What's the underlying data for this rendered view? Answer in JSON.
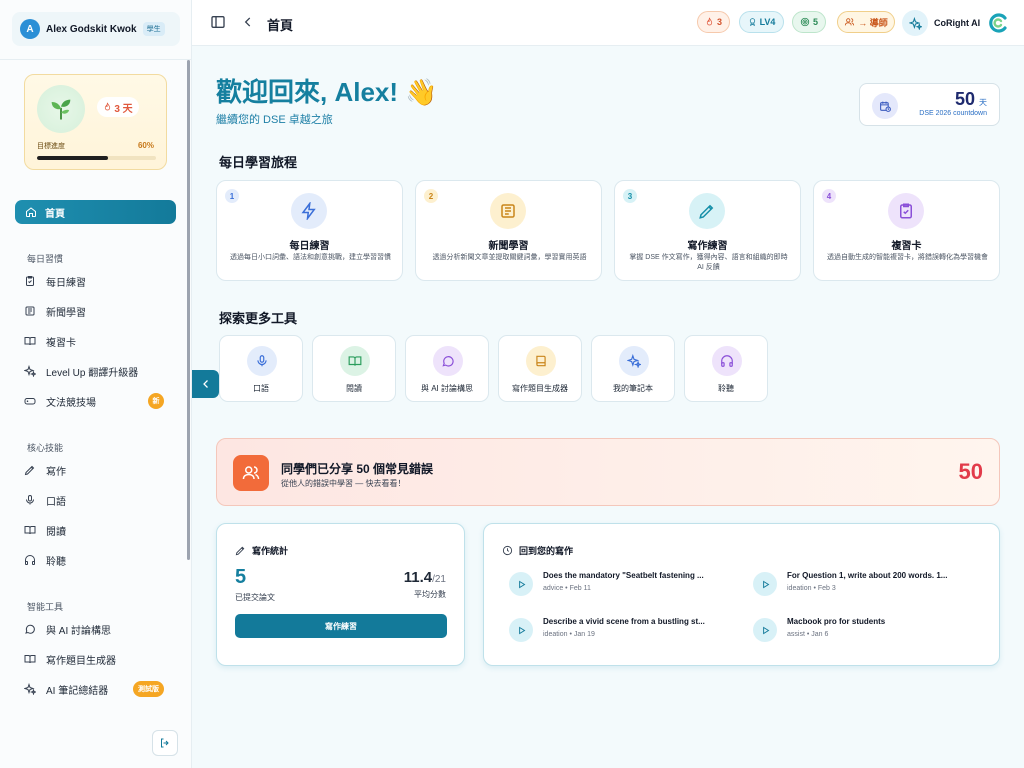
{
  "user": {
    "initial": "A",
    "name": "Alex Godskit Kwok",
    "role": "學生"
  },
  "streak": {
    "days": "3 天",
    "goal_label": "目標進度",
    "goal_pct_text": "60%",
    "goal_fraction": 0.6
  },
  "sidebar": {
    "home": "首頁",
    "sections": [
      {
        "label": "每日習慣",
        "items": [
          {
            "label": "每日練習",
            "icon": "clipboard-check-icon"
          },
          {
            "label": "新聞學習",
            "icon": "newspaper-icon"
          },
          {
            "label": "複習卡",
            "icon": "book-open-icon"
          },
          {
            "label": "Level Up 翻譯升級器",
            "icon": "sparkles-icon"
          },
          {
            "label": "文法競技場",
            "icon": "gamepad-icon",
            "badge": "新"
          }
        ]
      },
      {
        "label": "核心技能",
        "items": [
          {
            "label": "寫作",
            "icon": "pen-icon"
          },
          {
            "label": "口語",
            "icon": "mic-icon"
          },
          {
            "label": "閱讀",
            "icon": "book-open-icon"
          },
          {
            "label": "聆聽",
            "icon": "headphones-icon"
          }
        ]
      },
      {
        "label": "智能工具",
        "items": [
          {
            "label": "與 AI 討論構思",
            "icon": "chat-icon"
          },
          {
            "label": "寫作題目生成器",
            "icon": "book-open-icon"
          },
          {
            "label": "AI 筆記總結器",
            "icon": "sparkles-icon",
            "badge": "測試版"
          }
        ]
      }
    ]
  },
  "topbar": {
    "title": "首頁",
    "streak_count": "3",
    "level": "LV4",
    "coins": "5",
    "tutor_label": "→ 導師",
    "brand": "CoRight AI"
  },
  "hero": {
    "title": "歡迎回來, Alex! 👋",
    "subtitle": "繼續您的 DSE 卓越之旅"
  },
  "countdown": {
    "number": "50",
    "unit": "天",
    "label": "DSE 2026 countdown"
  },
  "journey": {
    "heading": "每日學習旅程",
    "cards": [
      {
        "num": "1",
        "title": "每日練習",
        "desc": "透過每日小口詞彙、語法和創意挑戰，建立學習習慣",
        "icon": "lightning-icon",
        "color": "#3b6fd8",
        "bg": "#e3ecfb",
        "numbg": "#e3ecfb"
      },
      {
        "num": "2",
        "title": "新聞學習",
        "desc": "透過分析新聞文章並提取關鍵詞彙，學習實用英語",
        "icon": "newspaper-icon",
        "color": "#c9851a",
        "bg": "#fdf0cf",
        "numbg": "#fdf0cf"
      },
      {
        "num": "3",
        "title": "寫作練習",
        "desc": "掌握 DSE 作文寫作，獲得內容、語言和組織的即時 AI 反饋",
        "icon": "pen-icon",
        "color": "#158fa8",
        "bg": "#d7f2f6",
        "numbg": "#d7f2f6"
      },
      {
        "num": "4",
        "title": "複習卡",
        "desc": "透過自動生成的智能複習卡，將錯誤轉化為學習機會",
        "icon": "clipboard-check-icon",
        "color": "#8a4fd8",
        "bg": "#eee3fb",
        "numbg": "#eee3fb"
      }
    ]
  },
  "tools": {
    "heading": "探索更多工具",
    "items": [
      {
        "label": "口語",
        "icon": "mic-icon",
        "color": "#3b6fd8",
        "bg": "#e3ecfb"
      },
      {
        "label": "閱讀",
        "icon": "book-open-icon",
        "color": "#2a9d5c",
        "bg": "#dcf3e5"
      },
      {
        "label": "與 AI 討論構思",
        "icon": "chat-icon",
        "color": "#8a4fd8",
        "bg": "#eee3fb"
      },
      {
        "label": "寫作題目生成器",
        "icon": "book-icon",
        "color": "#c9851a",
        "bg": "#fdf0cf"
      },
      {
        "label": "我的筆記本",
        "icon": "sparkles-icon",
        "color": "#3b6fd8",
        "bg": "#e3ecfb"
      },
      {
        "label": "聆聽",
        "icon": "headphones-icon",
        "color": "#8a4fd8",
        "bg": "#eee3fb"
      }
    ]
  },
  "banner": {
    "title": "同學們已分享 50 個常見錯誤",
    "subtitle": "從他人的錯誤中學習 — 快去看看！",
    "count": "50"
  },
  "stats": {
    "heading": "寫作統計",
    "count": "5",
    "count_label": "已提交論文",
    "avg_score": "11.4",
    "avg_max": "/21",
    "avg_label": "平均分數",
    "button": "寫作練習"
  },
  "recent": {
    "heading": "回到您的寫作",
    "items": [
      {
        "title": "Does the mandatory \"Seatbelt fastening ...",
        "meta": "advice • Feb 11"
      },
      {
        "title": "For Question 1, write about 200 words. 1...",
        "meta": "ideation • Feb 3"
      },
      {
        "title": "Describe a vivid scene from a bustling st...",
        "meta": "ideation • Jan 19"
      },
      {
        "title": "Macbook pro for students",
        "meta": "assist • Jan 6"
      }
    ]
  },
  "colors": {
    "primary": "#137a9a",
    "accent_orange": "#f5a623",
    "danger": "#e23b4a"
  }
}
